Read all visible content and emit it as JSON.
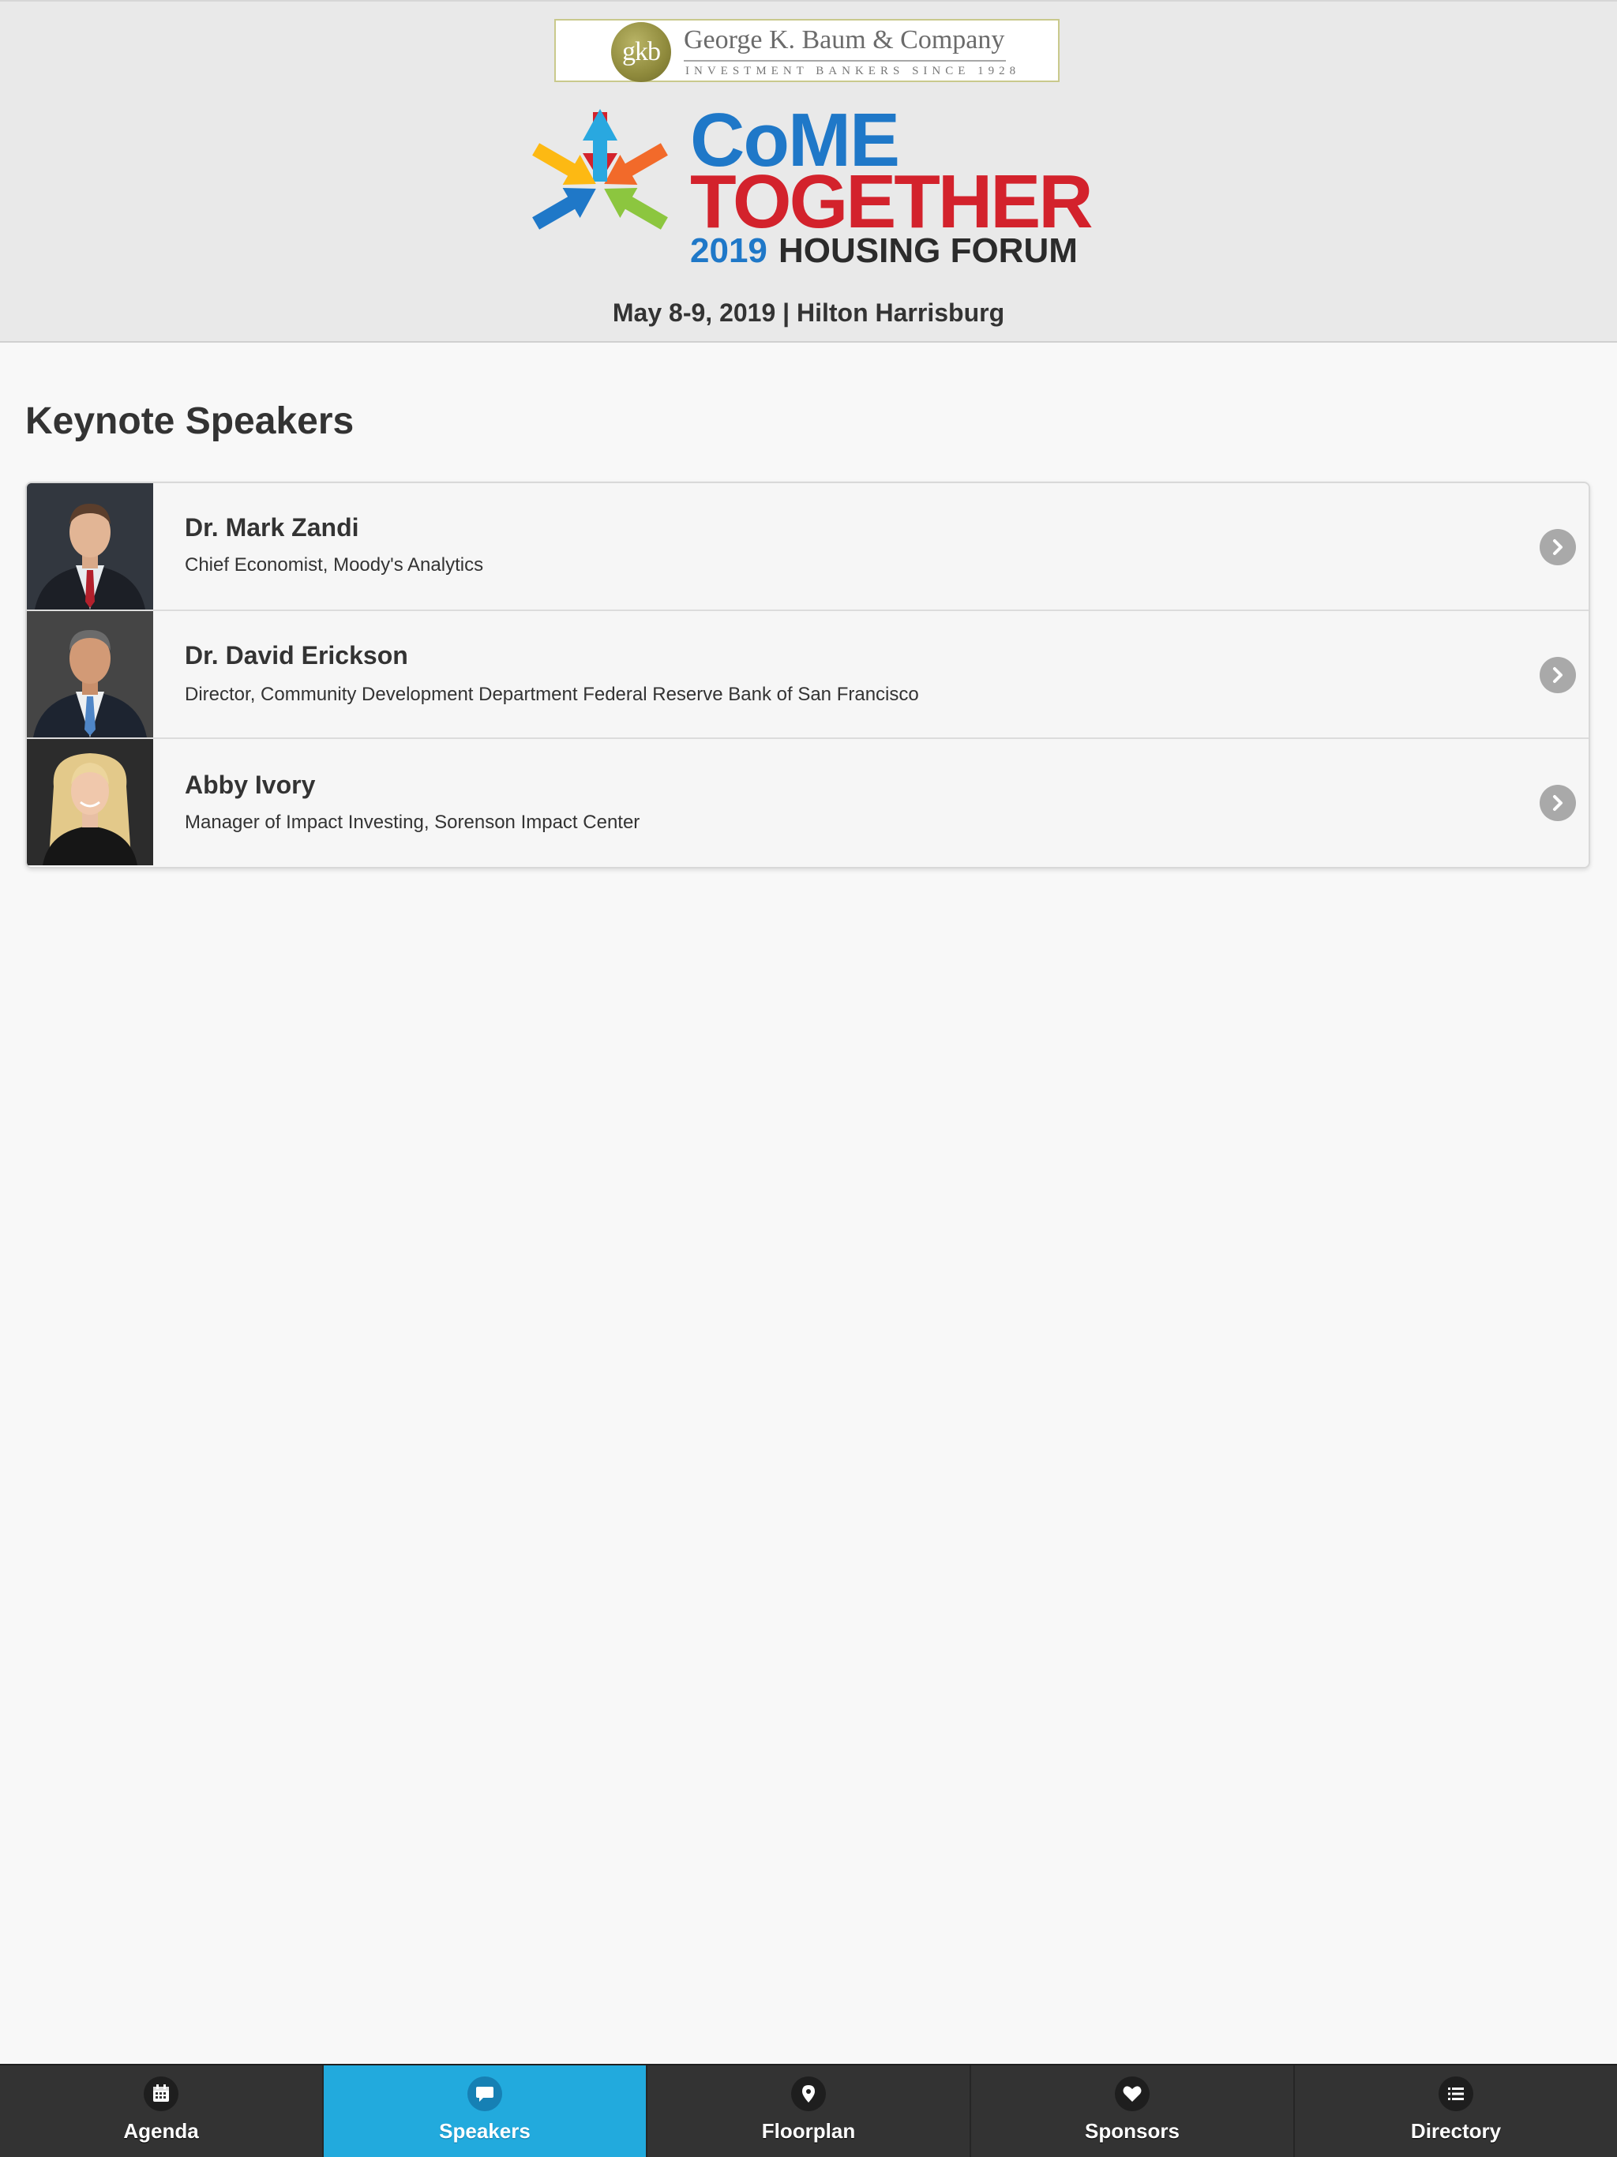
{
  "header": {
    "sponsor_seal_text": "gkb",
    "sponsor_name": "George K. Baum & Company",
    "sponsor_tagline": "INVESTMENT BANKERS SINCE 1928",
    "logo": {
      "line1": "CoME",
      "line2": "TOGETHER",
      "year": "2019",
      "subtitle": "HOUSING FORUM",
      "colors": [
        "#d3222c",
        "#f26a2a",
        "#8cc63f",
        "#29a8e0",
        "#1f78c8",
        "#fdb913"
      ]
    },
    "event_line": "May 8-9, 2019 | Hilton Harrisburg"
  },
  "main": {
    "section_title": "Keynote Speakers",
    "speakers": [
      {
        "name": "Dr. Mark Zandi",
        "title": "Chief Economist, Moody's Analytics"
      },
      {
        "name": "Dr. David Erickson",
        "title": "Director, Community Development Department Federal Reserve Bank of San Francisco"
      },
      {
        "name": "Abby Ivory",
        "title": "Manager of Impact Investing, Sorenson Impact Center"
      }
    ]
  },
  "tabbar": {
    "active_color": "#22aadd",
    "tabs": [
      {
        "label": "Agenda",
        "icon": "calendar-icon",
        "active": false
      },
      {
        "label": "Speakers",
        "icon": "speech-bubble-icon",
        "active": true
      },
      {
        "label": "Floorplan",
        "icon": "map-pin-icon",
        "active": false
      },
      {
        "label": "Sponsors",
        "icon": "heart-icon",
        "active": false
      },
      {
        "label": "Directory",
        "icon": "list-icon",
        "active": false
      }
    ]
  }
}
